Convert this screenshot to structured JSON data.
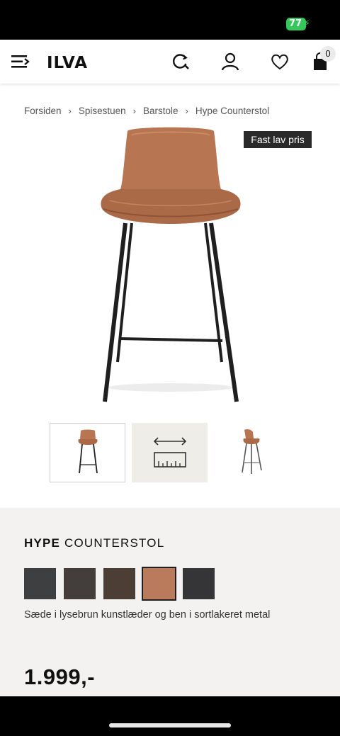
{
  "status_bar": {
    "battery": "77"
  },
  "header": {
    "logo": "ILVA",
    "menu_icon": "hamburger-menu-icon",
    "icons": [
      "search-icon",
      "account-icon",
      "heart-icon",
      "cart-icon"
    ],
    "cart_count": "0"
  },
  "breadcrumb": {
    "items": [
      "Forsiden",
      "Spisestuen",
      "Barstole",
      "Hype Counterstol"
    ],
    "separator": "›"
  },
  "product": {
    "badge": "Fast lav pris",
    "title_brand": "HYPE",
    "title_name": "COUNTERSTOL",
    "description": "Sæde i lysebrun kunstlæder og ben i sortlakeret metal",
    "price": "1.999,-",
    "swatches": [
      {
        "color": "#3d3f41",
        "selected": false
      },
      {
        "color": "#433d3b",
        "selected": false
      },
      {
        "color": "#4d3e35",
        "selected": false
      },
      {
        "color": "#b97b5b",
        "selected": true
      },
      {
        "color": "#353537",
        "selected": false
      }
    ],
    "thumbnails": [
      "chair-front",
      "dimensions-icon",
      "chair-side"
    ]
  },
  "colors": {
    "seat_leather": "#b87551",
    "legs": "#1f1f1f",
    "panel_bg": "#f3f2f0",
    "battery": "#34c759"
  }
}
